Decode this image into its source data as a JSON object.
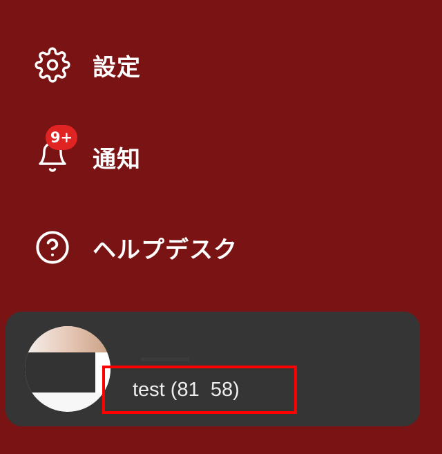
{
  "menu": {
    "settings": {
      "label": "設定",
      "icon": "gear-icon"
    },
    "notifications": {
      "label": "通知",
      "icon": "bell-icon",
      "badge": "9+"
    },
    "helpdesk": {
      "label": "ヘルプデスク",
      "icon": "question-circle-icon"
    }
  },
  "user": {
    "display": "test (81  58)"
  },
  "colors": {
    "sidebar_bg": "#7a1414",
    "card_bg": "#353535",
    "badge_bg": "#e02424",
    "highlight": "#ff0000"
  }
}
